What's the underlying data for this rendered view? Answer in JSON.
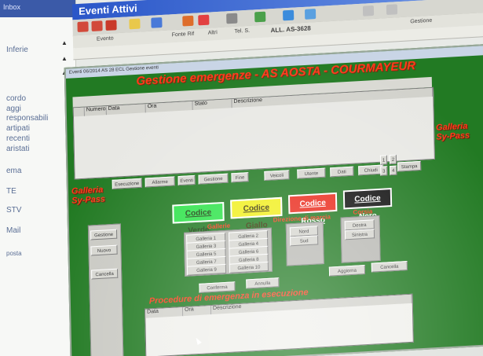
{
  "left_pane": {
    "header": "Inbox",
    "items": [
      "Inferie",
      "cordo",
      "aggi",
      "responsabili",
      "artipati",
      "recenti",
      "aristati",
      "ema",
      "TE",
      "STV",
      "Mail",
      "posta"
    ]
  },
  "window_title": "Eventi Attivi",
  "ribbon_labels": [
    "Evento",
    "Fonte Rif",
    "Altri",
    "Tel. S.",
    "ALL. AS-3628"
  ],
  "toolbar_label": "Gestione",
  "inner_window_title": "Eventi 06/2014  AS 28 ECL  Gestione eventi",
  "form_title": "Gestione emergenze - AS AOSTA - COURMAYEUR",
  "grid_columns": [
    "Numero",
    "Data",
    "Ora",
    "Stato",
    "Descrizione"
  ],
  "left_tunnel_label": [
    "Galleria",
    "Sy-Pass"
  ],
  "right_tunnel_label": [
    "Galleria",
    "Sy-Pass"
  ],
  "tab_buttons": [
    "Esecuzione",
    "Allarme",
    "Eventi",
    "Gestione",
    "Fine",
    "Veicoli",
    "Utente",
    "Dati",
    "Chiudi",
    "Stampa"
  ],
  "code_buttons": [
    {
      "label": "Codice Verde",
      "bg": "#2ee34a",
      "color": "#1a3f10"
    },
    {
      "label": "Codice Giallo",
      "bg": "#f1ef1e",
      "color": "#3a3308"
    },
    {
      "label": "Codice Rosso",
      "bg": "#ea2a1c",
      "color": "#ffffff"
    },
    {
      "label": "Codice Nero",
      "bg": "#111111",
      "color": "#ffffff"
    }
  ],
  "group_titles": [
    "Gallerie",
    "Direzione di marcia",
    "Corsia"
  ],
  "gallerie_buttons": [
    "Galleria 1",
    "Galleria 2",
    "Galleria 3",
    "Galleria 4",
    "Galleria 5",
    "Galleria 6",
    "Galleria 7",
    "Galleria 8",
    "Galleria 9",
    "Galleria 10"
  ],
  "direction_buttons": [
    "Nord",
    "Sud"
  ],
  "lane_buttons": [
    "Destra",
    "Sinistra"
  ],
  "side_buttons": [
    "Gestione",
    "Nuovo",
    "Cancella"
  ],
  "small_buttons": [
    "Conferma",
    "Annulla",
    "Aggiorna",
    "Cancella"
  ],
  "bottom_title": "Procedure di emergenza in esecuzione",
  "bottom_columns": [
    "Data",
    "Ora",
    "Descrizione"
  ],
  "pager_buttons": [
    "1",
    "2",
    "3",
    "4"
  ],
  "colors": {
    "form_bg": "#227a23",
    "title_red": "#ff3a1a",
    "titlebar_blue": "#2a56c8"
  }
}
